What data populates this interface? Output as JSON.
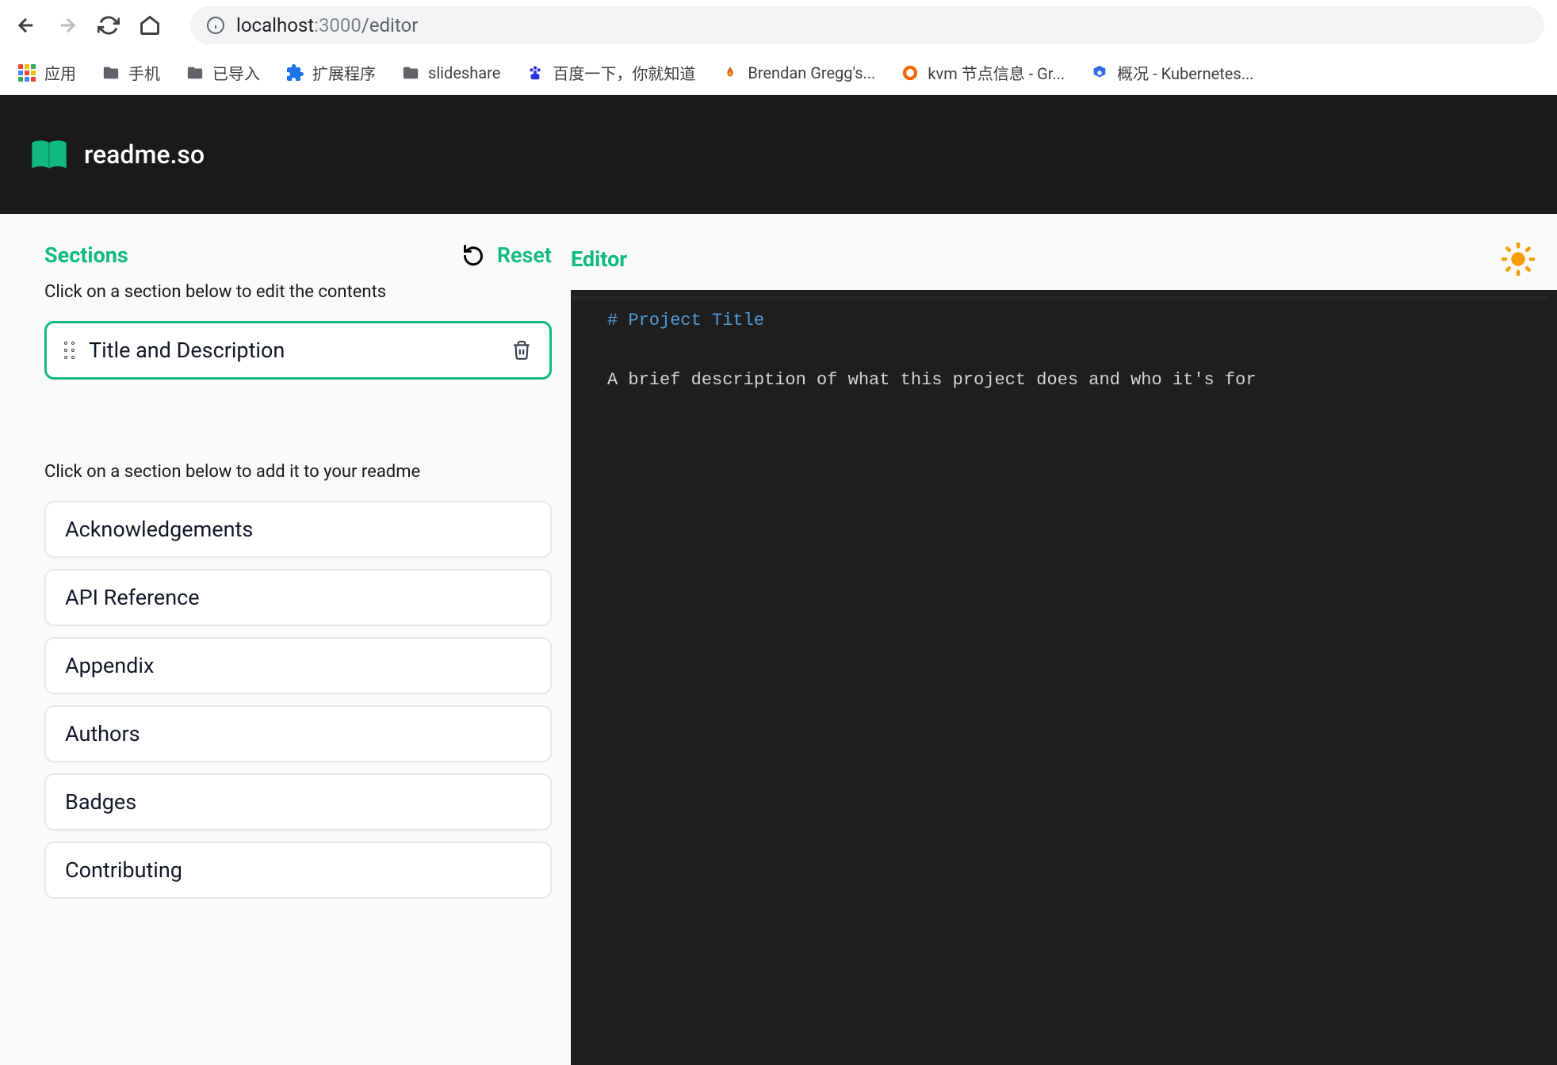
{
  "browser": {
    "url_host": "localhost",
    "url_port": ":3000",
    "url_path": "/editor"
  },
  "bookmarks": [
    {
      "label": "应用",
      "icon": "apps"
    },
    {
      "label": "手机",
      "icon": "folder"
    },
    {
      "label": "已导入",
      "icon": "folder"
    },
    {
      "label": "扩展程序",
      "icon": "extension"
    },
    {
      "label": "slideshare",
      "icon": "folder"
    },
    {
      "label": "百度一下，你就知道",
      "icon": "baidu"
    },
    {
      "label": "Brendan Gregg's...",
      "icon": "flame"
    },
    {
      "label": "kvm 节点信息 - Gr...",
      "icon": "grafana"
    },
    {
      "label": "概况 - Kubernetes...",
      "icon": "kube"
    }
  ],
  "app": {
    "title": "readme.so"
  },
  "sidebar": {
    "heading": "Sections",
    "reset_label": "Reset",
    "instruction_edit": "Click on a section below to edit the contents",
    "instruction_add": "Click on a section below to add it to your readme",
    "active_section": {
      "label": "Title and Description"
    },
    "available": [
      {
        "label": "Acknowledgements"
      },
      {
        "label": "API Reference"
      },
      {
        "label": "Appendix"
      },
      {
        "label": "Authors"
      },
      {
        "label": "Badges"
      },
      {
        "label": "Contributing"
      }
    ]
  },
  "editor": {
    "heading": "Editor",
    "line1": "# Project Title",
    "line2": "A brief description of what this project does and who it's for"
  }
}
